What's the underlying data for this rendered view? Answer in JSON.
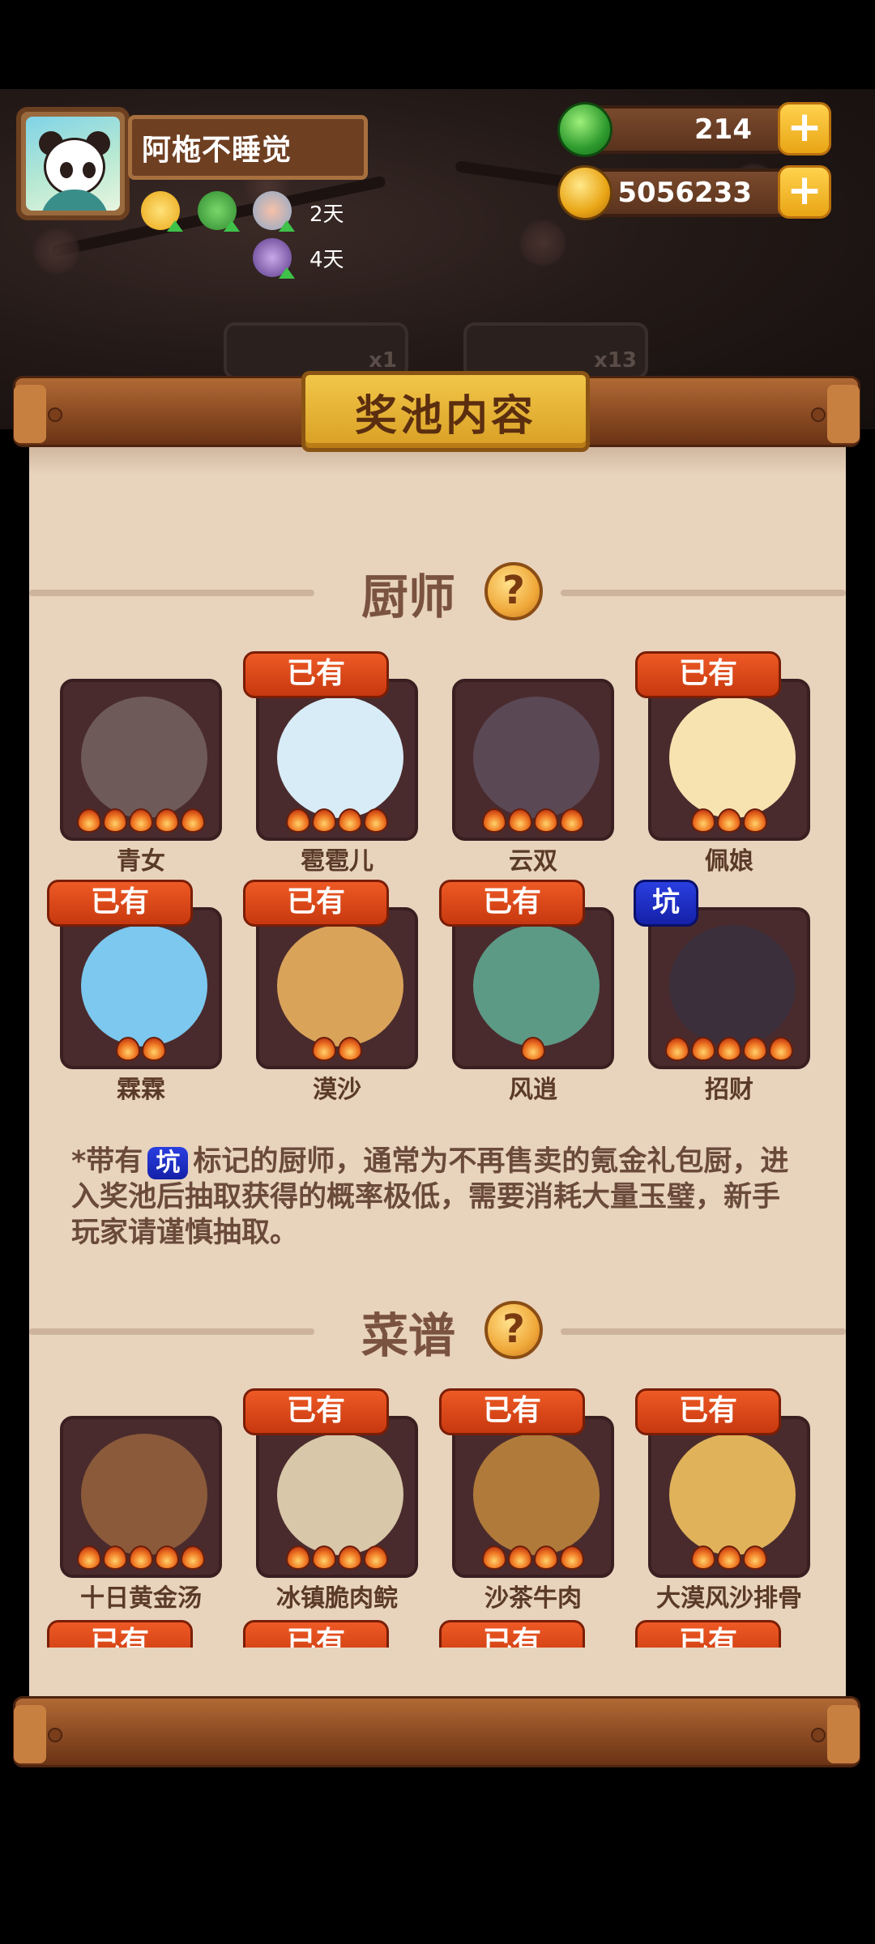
{
  "profile": {
    "name": "阿柂不睡觉",
    "buffs": [
      {
        "icon": "gold-coin-buff-icon",
        "label": ""
      },
      {
        "icon": "jade-buff-icon",
        "label": ""
      },
      {
        "icon": "rice-bowl-buff-icon",
        "label": "2天"
      },
      {
        "icon": "chef-buff-icon",
        "label": "4天"
      }
    ]
  },
  "currency": {
    "jade": "214",
    "gold": "5056233"
  },
  "pools": [
    {
      "count": "x1"
    },
    {
      "count": "x13"
    }
  ],
  "title": "奖池内容",
  "chefs_section": {
    "heading": "厨师",
    "help": "?",
    "items": [
      {
        "name": "青女",
        "tag": "",
        "flames": 5,
        "art_color": "#6e5a58"
      },
      {
        "name": "雹雹儿",
        "tag": "已有",
        "flames": 4,
        "art_color": "#d8ecf7"
      },
      {
        "name": "云双",
        "tag": "",
        "flames": 4,
        "art_color": "#5a4855"
      },
      {
        "name": "佩娘",
        "tag": "已有",
        "flames": 3,
        "art_color": "#f7e3b0"
      },
      {
        "name": "霖霖",
        "tag": "已有",
        "flames": 2,
        "art_color": "#7cc8ef"
      },
      {
        "name": "漠沙",
        "tag": "已有",
        "flames": 2,
        "art_color": "#d9a35a"
      },
      {
        "name": "风逍",
        "tag": "已有",
        "flames": 1,
        "art_color": "#5d9a86"
      },
      {
        "name": "招财",
        "tag": "坑",
        "flames": 5,
        "art_color": "#3b2f3c"
      }
    ]
  },
  "note": {
    "prefix": "*带有",
    "pit_label": "坑",
    "text": "标记的厨师，通常为不再售卖的氪金礼包厨，进入奖池后抽取获得的概率极低，需要消耗大量玉璧，新手玩家请谨慎抽取。"
  },
  "recipes_section": {
    "heading": "菜谱",
    "help": "?",
    "items": [
      {
        "name": "十日黄金汤",
        "tag": "",
        "flames": 5,
        "art_color": "#8a5a3a"
      },
      {
        "name": "冰镇脆肉鲩",
        "tag": "已有",
        "flames": 4,
        "art_color": "#d8c7a8"
      },
      {
        "name": "沙茶牛肉",
        "tag": "已有",
        "flames": 4,
        "art_color": "#b07a3a"
      },
      {
        "name": "大漠风沙排骨",
        "tag": "已有",
        "flames": 3,
        "art_color": "#e0b25a"
      }
    ],
    "next_row_tags": [
      "已有",
      "已有",
      "已有",
      "已有"
    ]
  },
  "colors": {
    "owned_tag": "#e04a1c",
    "pit_tag": "#1e2ec8",
    "parchment": "#e8d3bd",
    "card_bg": "#4a2b2d"
  }
}
